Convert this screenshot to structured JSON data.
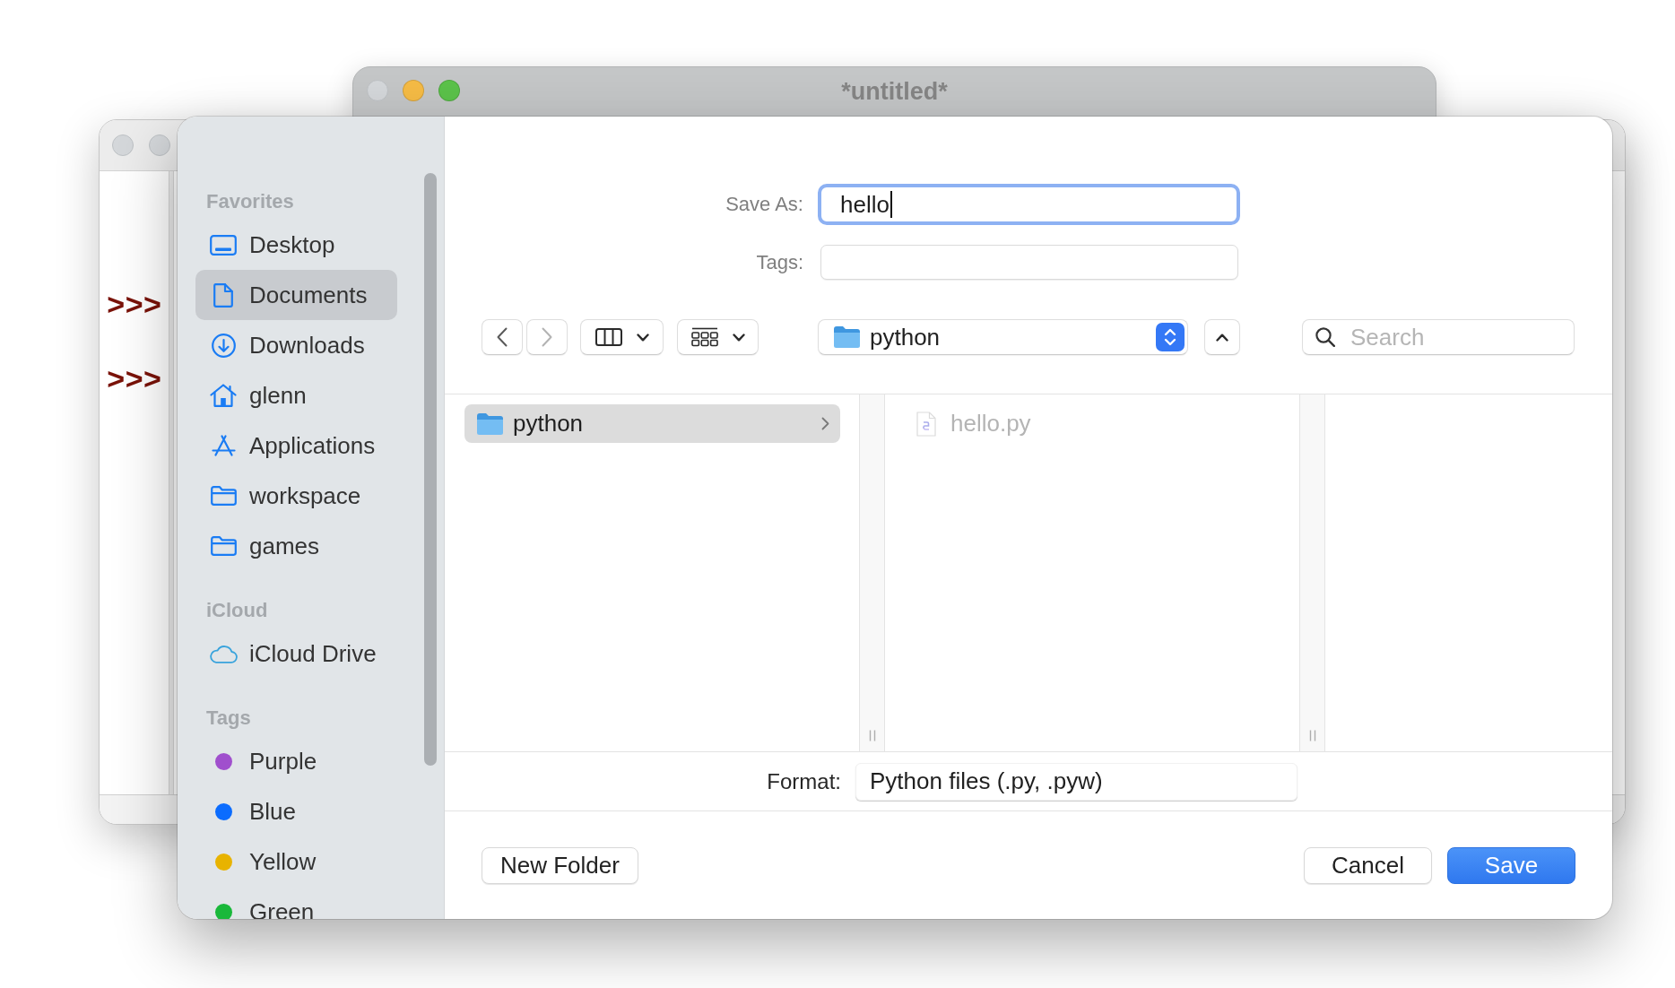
{
  "shell_window": {
    "active": false,
    "prompts": [
      ">>>",
      ">>>"
    ]
  },
  "editor_window": {
    "title": "*untitled*",
    "buttons": [
      {
        "kind": "close",
        "enabled": false
      },
      {
        "kind": "minimize",
        "enabled": true
      },
      {
        "kind": "zoom",
        "enabled": true
      }
    ]
  },
  "save_dialog": {
    "sidebar": {
      "sections": [
        {
          "heading": "Favorites",
          "items": [
            {
              "label": "Desktop",
              "kind": "desktop",
              "selected": false
            },
            {
              "label": "Documents",
              "kind": "document",
              "selected": true
            },
            {
              "label": "Downloads",
              "kind": "download",
              "selected": false
            },
            {
              "label": "glenn",
              "kind": "home",
              "selected": false
            },
            {
              "label": "Applications",
              "kind": "apps",
              "selected": false
            },
            {
              "label": "workspace",
              "kind": "folder",
              "selected": false
            },
            {
              "label": "games",
              "kind": "folder",
              "selected": false
            }
          ]
        },
        {
          "heading": "iCloud",
          "items": [
            {
              "label": "iCloud Drive",
              "kind": "cloud",
              "selected": false
            }
          ]
        },
        {
          "heading": "Tags",
          "items": [
            {
              "label": "Purple",
              "kind": "tag",
              "color": "#a04fcd",
              "selected": false
            },
            {
              "label": "Blue",
              "kind": "tag",
              "color": "#0b6cfe",
              "selected": false
            },
            {
              "label": "Yellow",
              "kind": "tag",
              "color": "#e8b300",
              "selected": false
            },
            {
              "label": "Green",
              "kind": "tag",
              "color": "#19b83a",
              "selected": false
            }
          ]
        }
      ]
    },
    "save_as": {
      "label": "Save As:",
      "value": "hello",
      "focused": true
    },
    "tags": {
      "label": "Tags:"
    },
    "toolbar": {
      "navigation": [
        {
          "kind": "back",
          "enabled": true
        },
        {
          "kind": "forward",
          "enabled": false
        }
      ],
      "location": "python",
      "search": {
        "placeholder": "Search"
      }
    },
    "browser": {
      "columns": [
        {
          "items": [
            {
              "label": "python",
              "kind": "folder",
              "selected": true,
              "enabled": true
            }
          ]
        },
        {
          "items": [
            {
              "label": "hello.py",
              "kind": "file",
              "selected": false,
              "enabled": false
            }
          ]
        }
      ]
    },
    "format": {
      "label": "Format:",
      "value": "Python files (.py, .pyw)"
    },
    "buttons": [
      {
        "label": "New Folder",
        "kind": "new_folder"
      },
      {
        "label": "Cancel",
        "kind": "cancel"
      },
      {
        "label": "Save",
        "kind": "save"
      }
    ]
  }
}
